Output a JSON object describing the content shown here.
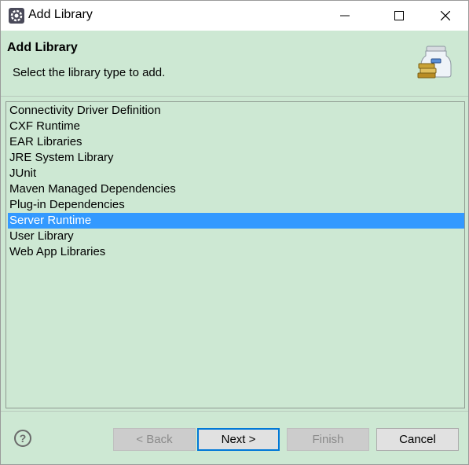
{
  "window": {
    "title": "Add Library",
    "icon": "eclipse-gear-icon"
  },
  "banner": {
    "title": "Add Library",
    "description": "Select the library type to add.",
    "icon": "library-jars-icon"
  },
  "library_types": {
    "items": [
      "Connectivity Driver Definition",
      "CXF Runtime",
      "EAR Libraries",
      "JRE System Library",
      "JUnit",
      "Maven Managed Dependencies",
      "Plug-in Dependencies",
      "Server Runtime",
      "User Library",
      "Web App Libraries"
    ],
    "selected": "Server Runtime"
  },
  "buttons": {
    "back": "< Back",
    "next": "Next >",
    "finish": "Finish",
    "cancel": "Cancel"
  },
  "colors": {
    "background": "#cde8d3",
    "selection": "#3399ff",
    "default_button_border": "#0078d7"
  }
}
